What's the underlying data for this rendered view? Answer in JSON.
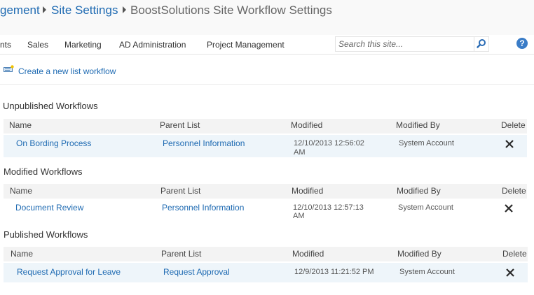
{
  "breadcrumb": {
    "items": [
      "gement",
      "Site Settings"
    ],
    "current": "BoostSolutions Site Workflow Settings"
  },
  "topnav": {
    "items": [
      "nts",
      "Sales",
      "Marketing",
      "AD Administration",
      "Project Management"
    ]
  },
  "search": {
    "placeholder": "Search this site..."
  },
  "help": {
    "label": "?"
  },
  "actions": {
    "create_workflow": "Create a new list workflow"
  },
  "columns": {
    "name": "Name",
    "parent_list": "Parent List",
    "modified": "Modified",
    "modified_by": "Modified By",
    "delete": "Delete"
  },
  "sections": [
    {
      "title": "Unpublished Workflows",
      "rows": [
        {
          "name": "On Bording Process",
          "parent_list": "Personnel Information",
          "modified_line1": "12/10/2013 12:56:02",
          "modified_line2": "AM",
          "modified_by": "System Account"
        }
      ]
    },
    {
      "title": "Modified Workflows",
      "rows": [
        {
          "name": "Document Review",
          "parent_list": "Personnel Information",
          "modified_line1": "12/10/2013 12:57:13",
          "modified_line2": "AM",
          "modified_by": "System Account"
        }
      ]
    },
    {
      "title": "Published Workflows",
      "rows": [
        {
          "name": "Request Approval for Leave",
          "parent_list": "Request Approval",
          "modified_line1": "12/9/2013 11:21:52 PM",
          "modified_line2": "",
          "modified_by": "System Account"
        }
      ]
    }
  ],
  "colors": {
    "link": "#1e6ab2",
    "header_row_bg": "#f3f3f3",
    "data_row_bg": "#eef5fa",
    "help_badge": "#3a7cc7"
  }
}
